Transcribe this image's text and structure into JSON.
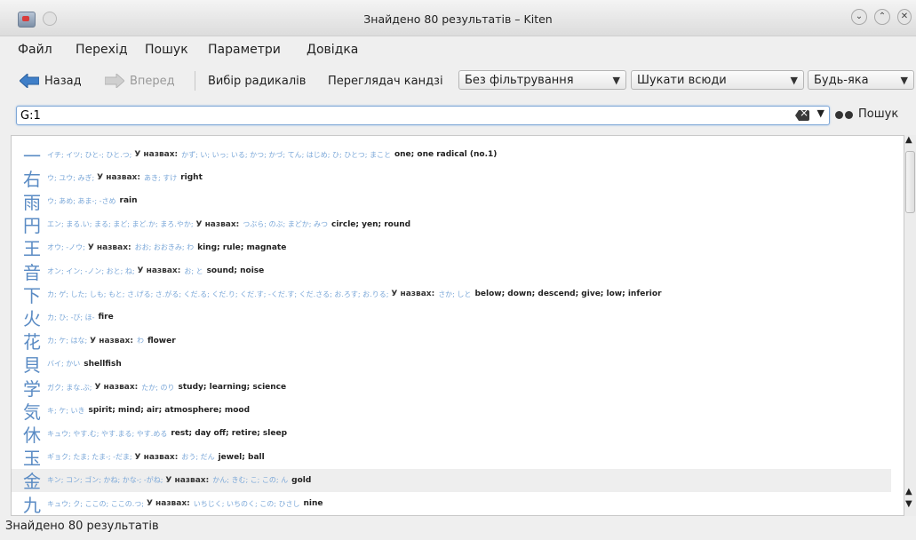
{
  "window": {
    "title": "Знайдено 80 результатів – Kiten"
  },
  "menu": [
    "Файл",
    "Перехід",
    "Пошук",
    "Параметри",
    "Довідка"
  ],
  "toolbar": {
    "back_label": "Назад",
    "forward_label": "Вперед",
    "radicals_label": "Вибір радикалів",
    "kanji_browser_label": "Переглядач кандзі",
    "filter_combo": "Без фільтрування",
    "scope_combo": "Шукати всюди",
    "match_combo": "Будь-яка"
  },
  "search": {
    "value": "G:1",
    "button_label": "Пошук"
  },
  "name_label": "У назвах:",
  "results": [
    {
      "kanji": "一",
      "readings": "イチ; イツ; ひと-; ひと.つ;",
      "names": "かず; い; いっ; いる; かつ; かづ; てん; はじめ; ひ; ひとつ; まこと",
      "meaning": "one; one radical (no.1)"
    },
    {
      "kanji": "右",
      "readings": "ウ; ユウ; みぎ;",
      "names": "あき; すけ",
      "meaning": "right"
    },
    {
      "kanji": "雨",
      "readings": "ウ; あめ; あま-; -さめ",
      "names": "",
      "meaning": "rain"
    },
    {
      "kanji": "円",
      "readings": "エン; まる.い; まる; まど; まど.か; まろ.やか;",
      "names": "つぶら; のぶ; まどか; みつ",
      "meaning": "circle; yen; round"
    },
    {
      "kanji": "王",
      "readings": "オウ; -ノウ;",
      "names": "おお; おおきみ; わ",
      "meaning": "king; rule; magnate"
    },
    {
      "kanji": "音",
      "readings": "オン; イン; -ノン; おと; ね;",
      "names": "お; と",
      "meaning": "sound; noise"
    },
    {
      "kanji": "下",
      "readings": "カ; ゲ; した; しも; もと; さ.げる; さ.がる; くだ.る; くだ.り; くだ.す; -くだ.す; くだ.さる; お.ろす; お.りる;",
      "names": "さか; しと",
      "meaning": "below; down; descend; give; low; inferior"
    },
    {
      "kanji": "火",
      "readings": "カ; ひ; -び; ほ-",
      "names": "",
      "meaning": "fire"
    },
    {
      "kanji": "花",
      "readings": "カ; ケ; はな;",
      "names": "わ",
      "meaning": "flower"
    },
    {
      "kanji": "貝",
      "readings": "バイ; かい",
      "names": "",
      "meaning": "shellfish"
    },
    {
      "kanji": "学",
      "readings": "ガク; まな.ぶ;",
      "names": "たか; のり",
      "meaning": "study; learning; science"
    },
    {
      "kanji": "気",
      "readings": "キ; ケ; いき",
      "names": "",
      "meaning": "spirit; mind; air; atmosphere; mood"
    },
    {
      "kanji": "休",
      "readings": "キュウ; やす.む; やす.まる; やす.める",
      "names": "",
      "meaning": "rest; day off; retire; sleep"
    },
    {
      "kanji": "玉",
      "readings": "ギョク; たま; たま-; -だま;",
      "names": "おう; だん",
      "meaning": "jewel; ball"
    },
    {
      "kanji": "金",
      "readings": "キン; コン; ゴン; かね; かな-; -がね;",
      "names": "かん; きむ; こ; この; ん",
      "meaning": "gold"
    },
    {
      "kanji": "九",
      "readings": "キュウ; ク; ここの; ここの.つ;",
      "names": "いちじく; いちのく; この; ひさし",
      "meaning": "nine"
    }
  ],
  "status": "Знайдено 80 результатів"
}
